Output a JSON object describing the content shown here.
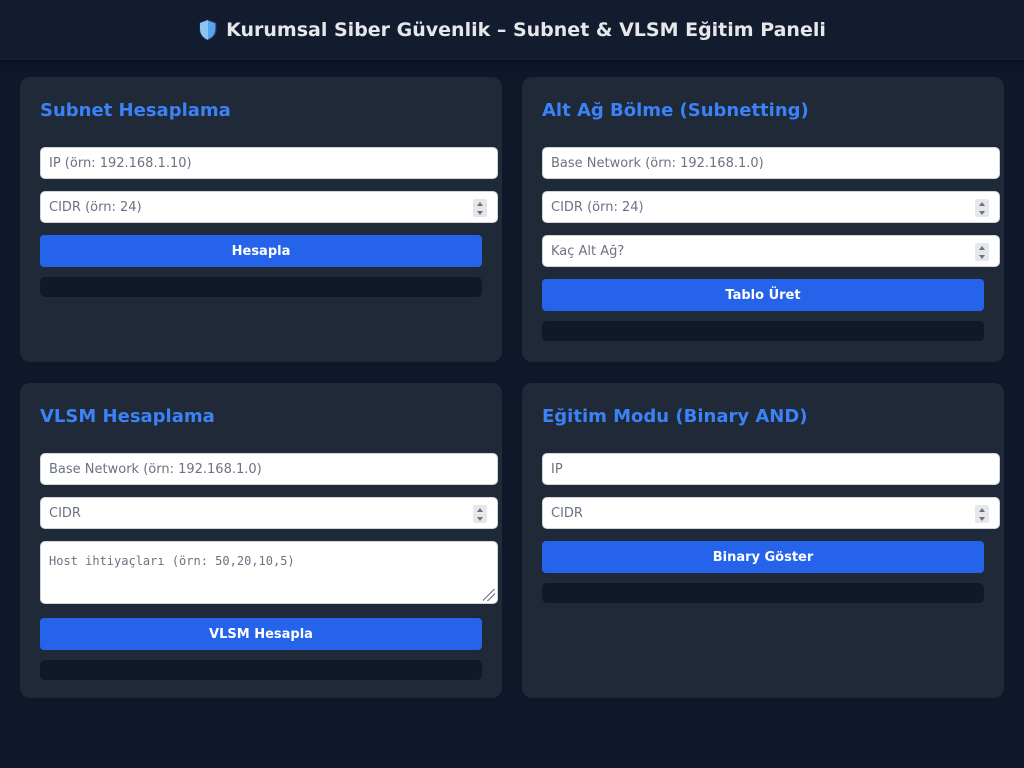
{
  "header": {
    "title": "Kurumsal Siber Güvenlik – Subnet & VLSM Eğitim Paneli",
    "icon": "shield-icon"
  },
  "colors": {
    "background": "#0f172a",
    "card": "#1f2937",
    "accent": "#3b82f6",
    "button": "#2563eb",
    "result": "#111827"
  },
  "subnet": {
    "title": "Subnet Hesaplama",
    "ip_placeholder": "IP (örn: 192.168.1.10)",
    "cidr_placeholder": "CIDR (örn: 24)",
    "button": "Hesapla"
  },
  "subnetting": {
    "title": "Alt Ağ Bölme (Subnetting)",
    "base_placeholder": "Base Network (örn: 192.168.1.0)",
    "cidr_placeholder": "CIDR (örn: 24)",
    "count_placeholder": "Kaç Alt Ağ?",
    "button": "Tablo Üret"
  },
  "vlsm": {
    "title": "VLSM Hesaplama",
    "base_placeholder": "Base Network (örn: 192.168.1.0)",
    "cidr_placeholder": "CIDR",
    "hosts_placeholder": "Host ihtiyaçları (örn: 50,20,10,5)",
    "button": "VLSM Hesapla"
  },
  "education": {
    "title": "Eğitim Modu (Binary AND)",
    "ip_placeholder": "IP",
    "cidr_placeholder": "CIDR",
    "button": "Binary Göster"
  }
}
